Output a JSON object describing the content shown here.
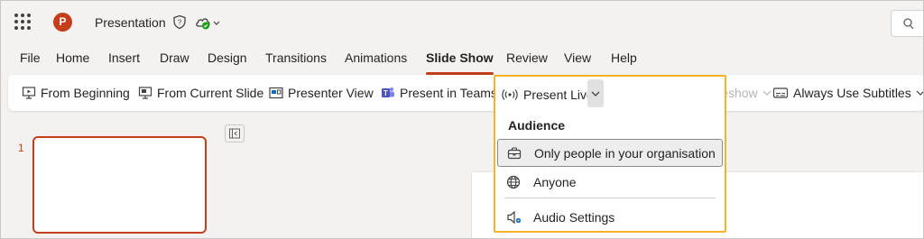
{
  "titlebar": {
    "app_icon": "powerpoint-icon",
    "app_icon_letter": "P",
    "document_title": "Presentation"
  },
  "tabs": [
    {
      "label": "File"
    },
    {
      "label": "Home"
    },
    {
      "label": "Insert"
    },
    {
      "label": "Draw"
    },
    {
      "label": "Design"
    },
    {
      "label": "Transitions"
    },
    {
      "label": "Animations"
    },
    {
      "label": "Slide Show",
      "active": true
    },
    {
      "label": "Review"
    },
    {
      "label": "View"
    },
    {
      "label": "Help"
    }
  ],
  "ribbon": {
    "from_beginning": "From Beginning",
    "from_current_slide": "From Current Slide",
    "presenter_view": "Presenter View",
    "present_in_teams": "Present in Teams",
    "present_live": "Present Live",
    "customised_slideshow": "Customised Slideshow",
    "always_use_subtitles": "Always Use Subtitles"
  },
  "slide_panel": {
    "slide_number": "1"
  },
  "present_live_menu": {
    "heading": "Audience",
    "items": [
      {
        "label": "Only people in your organisation",
        "icon": "briefcase-icon",
        "selected": true
      },
      {
        "label": "Anyone",
        "icon": "globe-icon"
      },
      {
        "label": "Audio Settings",
        "icon": "speaker-settings-icon"
      }
    ]
  },
  "colors": {
    "accent": "#c43e1c",
    "highlight_border": "#f5b325"
  }
}
